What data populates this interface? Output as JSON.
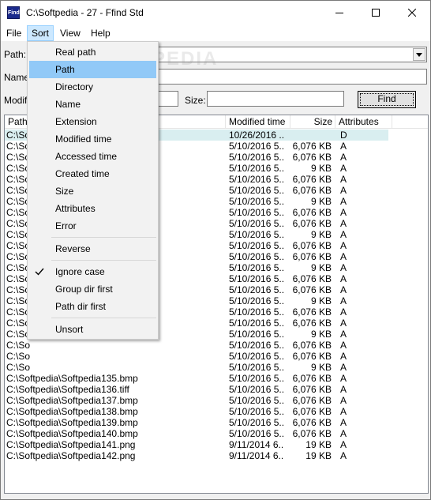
{
  "window": {
    "icon_text": "Find",
    "title": "C:\\Softpedia - 27 - Ffind Std"
  },
  "menubar": {
    "file": "File",
    "sort": "Sort",
    "view": "View",
    "help": "Help"
  },
  "form": {
    "path_label": "Path:",
    "name_label": "Name",
    "modified_label": "Modifi",
    "size_label": "Size:",
    "find_button": "Find",
    "path_value": "",
    "name_value": "",
    "size_value": ""
  },
  "list": {
    "columns": [
      "Path",
      "Modified time",
      "Size",
      "Attributes"
    ],
    "rows": [
      {
        "path": "C:\\Sof",
        "modified": "10/26/2016 ...",
        "size": "",
        "attr": "D"
      },
      {
        "path": "C:\\So",
        "modified": "5/10/2016 5...",
        "size": "6,076 KB",
        "attr": "A"
      },
      {
        "path": "C:\\So",
        "modified": "5/10/2016 5...",
        "size": "6,076 KB",
        "attr": "A"
      },
      {
        "path": "C:\\So",
        "modified": "5/10/2016 5...",
        "size": "9 KB",
        "attr": "A"
      },
      {
        "path": "C:\\So",
        "modified": "5/10/2016 5...",
        "size": "6,076 KB",
        "attr": "A"
      },
      {
        "path": "C:\\So",
        "modified": "5/10/2016 5...",
        "size": "6,076 KB",
        "attr": "A"
      },
      {
        "path": "C:\\So",
        "modified": "5/10/2016 5...",
        "size": "9 KB",
        "attr": "A"
      },
      {
        "path": "C:\\So",
        "modified": "5/10/2016 5...",
        "size": "6,076 KB",
        "attr": "A"
      },
      {
        "path": "C:\\So",
        "modified": "5/10/2016 5...",
        "size": "6,076 KB",
        "attr": "A"
      },
      {
        "path": "C:\\So",
        "modified": "5/10/2016 5...",
        "size": "9 KB",
        "attr": "A"
      },
      {
        "path": "C:\\So",
        "modified": "5/10/2016 5...",
        "size": "6,076 KB",
        "attr": "A"
      },
      {
        "path": "C:\\So",
        "modified": "5/10/2016 5...",
        "size": "6,076 KB",
        "attr": "A"
      },
      {
        "path": "C:\\So",
        "modified": "5/10/2016 5...",
        "size": "9 KB",
        "attr": "A"
      },
      {
        "path": "C:\\So",
        "modified": "5/10/2016 5...",
        "size": "6,076 KB",
        "attr": "A"
      },
      {
        "path": "C:\\So",
        "modified": "5/10/2016 5...",
        "size": "6,076 KB",
        "attr": "A"
      },
      {
        "path": "C:\\So",
        "modified": "5/10/2016 5...",
        "size": "9 KB",
        "attr": "A"
      },
      {
        "path": "C:\\So",
        "modified": "5/10/2016 5...",
        "size": "6,076 KB",
        "attr": "A"
      },
      {
        "path": "C:\\So",
        "modified": "5/10/2016 5...",
        "size": "6,076 KB",
        "attr": "A"
      },
      {
        "path": "C:\\So",
        "modified": "5/10/2016 5...",
        "size": "9 KB",
        "attr": "A"
      },
      {
        "path": "C:\\So",
        "modified": "5/10/2016 5...",
        "size": "6,076 KB",
        "attr": "A"
      },
      {
        "path": "C:\\So",
        "modified": "5/10/2016 5...",
        "size": "6,076 KB",
        "attr": "A"
      },
      {
        "path": "C:\\So",
        "modified": "5/10/2016 5...",
        "size": "9 KB",
        "attr": "A"
      },
      {
        "path": "C:\\Softpedia\\Softpedia135.bmp",
        "modified": "5/10/2016 5...",
        "size": "6,076 KB",
        "attr": "A"
      },
      {
        "path": "C:\\Softpedia\\Softpedia136.tiff",
        "modified": "5/10/2016 5...",
        "size": "6,076 KB",
        "attr": "A"
      },
      {
        "path": "C:\\Softpedia\\Softpedia137.bmp",
        "modified": "5/10/2016 5...",
        "size": "6,076 KB",
        "attr": "A"
      },
      {
        "path": "C:\\Softpedia\\Softpedia138.bmp",
        "modified": "5/10/2016 5...",
        "size": "6,076 KB",
        "attr": "A"
      },
      {
        "path": "C:\\Softpedia\\Softpedia139.bmp",
        "modified": "5/10/2016 5...",
        "size": "6,076 KB",
        "attr": "A"
      },
      {
        "path": "C:\\Softpedia\\Softpedia140.bmp",
        "modified": "5/10/2016 5...",
        "size": "6,076 KB",
        "attr": "A"
      },
      {
        "path": "C:\\Softpedia\\Softpedia141.png",
        "modified": "9/11/2014 6...",
        "size": "19 KB",
        "attr": "A"
      },
      {
        "path": "C:\\Softpedia\\Softpedia142.png",
        "modified": "9/11/2014 6...",
        "size": "19 KB",
        "attr": "A"
      }
    ]
  },
  "sort_menu": {
    "items": [
      "Real path",
      "Path",
      "Directory",
      "Name",
      "Extension",
      "Modified time",
      "Accessed time",
      "Created time",
      "Size",
      "Attributes",
      "Error",
      "Reverse",
      "Ignore case",
      "Group dir first",
      "Path dir first",
      "Unsort"
    ],
    "hovered": "Path",
    "checked": "Ignore case"
  },
  "watermark": "SOFTPEDIA",
  "colors": {
    "menu_hover": "#91c9f7",
    "menubar_active": "#cce8ff",
    "selected_row": "#d9eef0"
  }
}
